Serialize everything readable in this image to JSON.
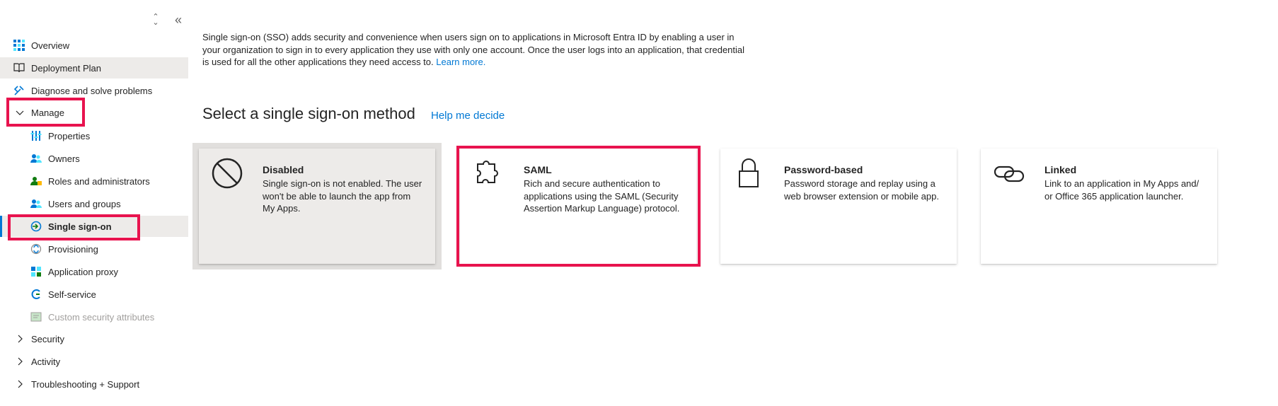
{
  "sidebar": {
    "items": [
      {
        "label": "Overview",
        "icon": "grid-icon"
      },
      {
        "label": "Deployment Plan",
        "icon": "book-icon"
      },
      {
        "label": "Diagnose and solve problems",
        "icon": "wrench-icon"
      },
      {
        "label": "Manage",
        "icon": "chevron-down-icon"
      },
      {
        "label": "Properties",
        "icon": "properties-icon"
      },
      {
        "label": "Owners",
        "icon": "owners-icon"
      },
      {
        "label": "Roles and administrators",
        "icon": "roles-icon"
      },
      {
        "label": "Users and groups",
        "icon": "users-icon"
      },
      {
        "label": "Single sign-on",
        "icon": "sso-icon"
      },
      {
        "label": "Provisioning",
        "icon": "provisioning-icon"
      },
      {
        "label": "Application proxy",
        "icon": "app-proxy-icon"
      },
      {
        "label": "Self-service",
        "icon": "self-service-icon"
      },
      {
        "label": "Custom security attributes",
        "icon": "custom-attributes-icon"
      },
      {
        "label": "Security",
        "icon": "chevron-right-icon"
      },
      {
        "label": "Activity",
        "icon": "chevron-right-icon"
      },
      {
        "label": "Troubleshooting + Support",
        "icon": "chevron-right-icon"
      }
    ]
  },
  "main": {
    "description": "Single sign-on (SSO) adds security and convenience when users sign on to applications in Microsoft Entra ID by enabling a user in your organization to sign in to every application they use with only one account. Once the user logs into an application, that credential is used for all the other applications they need access to.",
    "learn_more": "Learn more.",
    "section_title": "Select a single sign-on method",
    "help_link": "Help me decide",
    "cards": [
      {
        "title": "Disabled",
        "desc": "Single sign-on is not enabled. The user won't be able to launch the app from My Apps.",
        "icon": "disabled-circle-icon"
      },
      {
        "title": "SAML",
        "desc": "Rich and secure authentication to applications using the SAML (Security Assertion Markup Language) protocol.",
        "icon": "puzzle-icon"
      },
      {
        "title": "Password-based",
        "desc": "Password storage and replay using a web browser extension or mobile app.",
        "icon": "lock-icon"
      },
      {
        "title": "Linked",
        "desc": "Link to an application in My Apps and/ or Office 365 application launcher.",
        "icon": "link-icon"
      }
    ]
  },
  "colors": {
    "accent": "#0078d4",
    "highlight": "#e8134e",
    "selected_bg": "#edebe9"
  }
}
